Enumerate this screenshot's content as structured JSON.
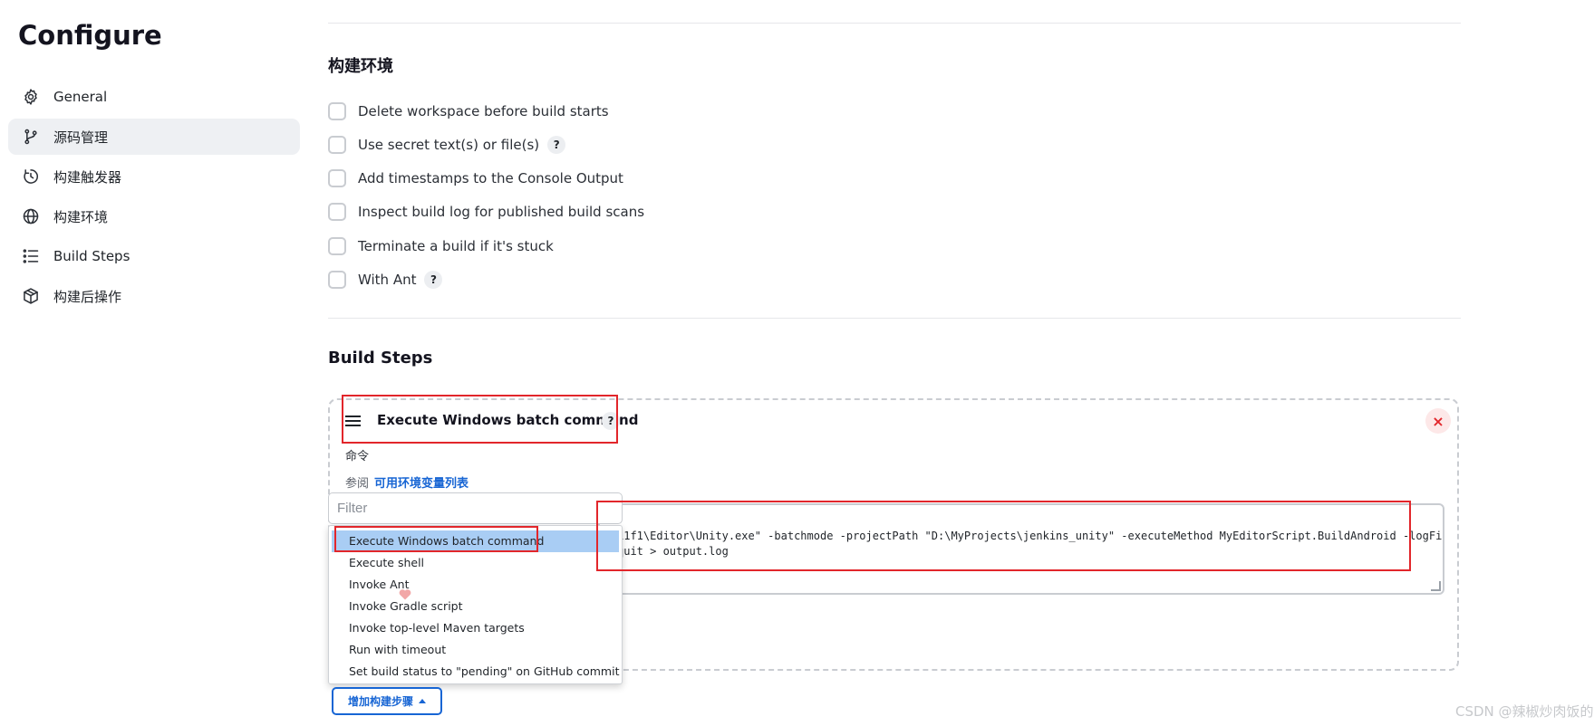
{
  "page": {
    "title": "Configure"
  },
  "sidebar": {
    "items": [
      {
        "label": "General",
        "icon": "gear-icon",
        "active": false
      },
      {
        "label": "源码管理",
        "icon": "branch-icon",
        "active": true
      },
      {
        "label": "构建触发器",
        "icon": "clock-icon",
        "active": false
      },
      {
        "label": "构建环境",
        "icon": "globe-icon",
        "active": false
      },
      {
        "label": "Build Steps",
        "icon": "list-icon",
        "active": false
      },
      {
        "label": "构建后操作",
        "icon": "cube-icon",
        "active": false
      }
    ]
  },
  "build_env": {
    "title": "构建环境",
    "options": [
      {
        "label": "Delete workspace before build starts",
        "help": "",
        "checked": false
      },
      {
        "label": "Use secret text(s) or file(s)",
        "help": "?",
        "checked": false
      },
      {
        "label": "Add timestamps to the Console Output",
        "help": "",
        "checked": false
      },
      {
        "label": "Inspect build log for published build scans",
        "help": "",
        "checked": false
      },
      {
        "label": "Terminate a build if it's stuck",
        "help": "",
        "checked": false
      },
      {
        "label": "With Ant",
        "help": "?",
        "checked": false
      }
    ]
  },
  "build_steps": {
    "title": "Build Steps",
    "step": {
      "title": "Execute Windows batch command",
      "help": "?",
      "close": "×",
      "command_label": "命令",
      "env_prefix": "参阅",
      "env_link": "可用环境变量列表",
      "command_line1": "11f1\\Editor\\Unity.exe\" -batchmode -projectPath \"D:\\MyProjects\\jenkins_unity\" -executeMethod MyEditorScript.BuildAndroid -logFile",
      "command_line2": "quit > output.log"
    },
    "filter": {
      "placeholder": "Filter",
      "value": ""
    },
    "dropdown": {
      "selected_index": 0,
      "items": [
        "Execute Windows batch command",
        "Execute shell",
        "Invoke Ant",
        "Invoke Gradle script",
        "Invoke top-level Maven targets",
        "Run with timeout",
        "Set build status to \"pending\" on GitHub commit"
      ]
    },
    "add_button": "增加构建步骤"
  },
  "watermark": "CSDN @辣椒炒肉饭的",
  "colors": {
    "accent": "#1765d4",
    "highlight_red": "#e2262b",
    "selected_bg": "#a9cdf4",
    "active_nav_bg": "#eef0f3"
  }
}
